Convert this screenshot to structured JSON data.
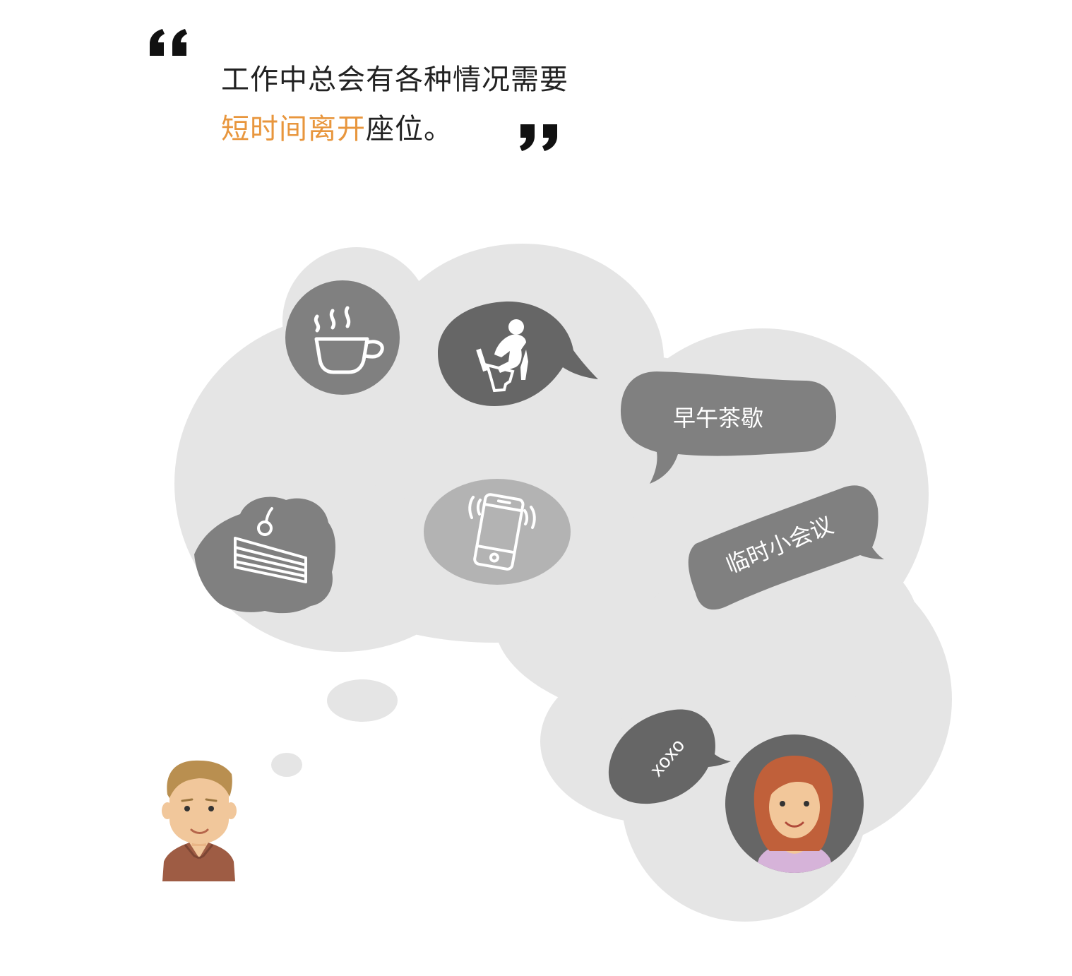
{
  "quote": {
    "line1": "工作中总会有各种情况需要",
    "line2_highlight": "短时间离开",
    "line2_rest": "座位。"
  },
  "bubbles": {
    "tea_break": "早午茶歇",
    "meeting": "临时小会议",
    "chat": "xoxo"
  },
  "icons": [
    "coffee-cup-icon",
    "toilet-icon",
    "cake-icon",
    "phone-ringing-icon",
    "man-avatar",
    "woman-avatar",
    "open-quote-icon",
    "close-quote-icon"
  ],
  "colors": {
    "highlight": "#e8963d",
    "cloud": "#e5e5e5",
    "dark_bubble": "#666666",
    "mid_bubble": "#808080",
    "light_bubble": "#b3b3b3"
  }
}
